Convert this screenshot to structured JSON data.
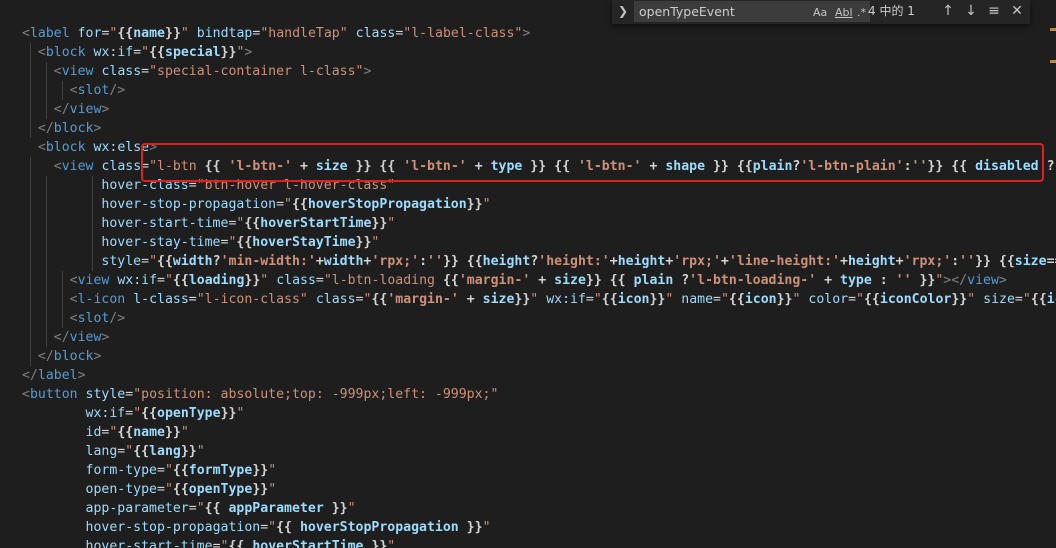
{
  "find": {
    "toggle_icon": "chevron-right-icon",
    "query": "openTypeEvent",
    "options": [
      "Aa",
      "Abl",
      ".*"
    ],
    "count": "4 中的 1",
    "prev_icon": "arrow-up-icon",
    "next_icon": "arrow-down-icon",
    "selection_icon": "find-in-selection-icon",
    "close_icon": "close-icon"
  },
  "colors": {
    "background": "#1e1e1e",
    "tag": "#569cd6",
    "attribute": "#9cdcfe",
    "string": "#ce9178",
    "punctuation": "#808080",
    "highlight_box": "#e0201c"
  },
  "lines": [
    [
      [
        "pun",
        "<"
      ],
      [
        "tag",
        "label"
      ],
      [
        "txt",
        " "
      ],
      [
        "attr",
        "for"
      ],
      [
        "txt",
        "="
      ],
      [
        "str",
        "\""
      ],
      [
        "expp",
        "{{"
      ],
      [
        "expr",
        "name"
      ],
      [
        "expp",
        "}}"
      ],
      [
        "str",
        "\""
      ],
      [
        "txt",
        " "
      ],
      [
        "attr",
        "bindtap"
      ],
      [
        "txt",
        "="
      ],
      [
        "str",
        "\"handleTap\""
      ],
      [
        "txt",
        " "
      ],
      [
        "attr",
        "class"
      ],
      [
        "txt",
        "="
      ],
      [
        "str",
        "\"l-label-class\""
      ],
      [
        "pun",
        ">"
      ]
    ],
    [
      [
        "txt",
        "  "
      ],
      [
        "pun",
        "<"
      ],
      [
        "tag",
        "block"
      ],
      [
        "txt",
        " "
      ],
      [
        "attr",
        "wx:if"
      ],
      [
        "txt",
        "="
      ],
      [
        "str",
        "\""
      ],
      [
        "expp",
        "{{"
      ],
      [
        "expr",
        "special"
      ],
      [
        "expp",
        "}}"
      ],
      [
        "str",
        "\""
      ],
      [
        "pun",
        ">"
      ]
    ],
    [
      [
        "txt",
        "    "
      ],
      [
        "pun",
        "<"
      ],
      [
        "tag",
        "view"
      ],
      [
        "txt",
        " "
      ],
      [
        "attr",
        "class"
      ],
      [
        "txt",
        "="
      ],
      [
        "str",
        "\"special-container l-class\""
      ],
      [
        "pun",
        ">"
      ]
    ],
    [
      [
        "txt",
        "      "
      ],
      [
        "pun",
        "<"
      ],
      [
        "tag",
        "slot"
      ],
      [
        "pun",
        "/>"
      ]
    ],
    [
      [
        "txt",
        "    "
      ],
      [
        "pun",
        "</"
      ],
      [
        "tag",
        "view"
      ],
      [
        "pun",
        ">"
      ]
    ],
    [
      [
        "txt",
        "  "
      ],
      [
        "pun",
        "</"
      ],
      [
        "tag",
        "block"
      ],
      [
        "pun",
        ">"
      ]
    ],
    [
      [
        "txt",
        "  "
      ],
      [
        "pun",
        "<"
      ],
      [
        "tag",
        "block"
      ],
      [
        "txt",
        " "
      ],
      [
        "attr",
        "wx:else"
      ],
      [
        "pun",
        ">"
      ]
    ],
    [
      [
        "txt",
        "    "
      ],
      [
        "pun",
        "<"
      ],
      [
        "tag",
        "view"
      ],
      [
        "txt",
        " "
      ],
      [
        "attr",
        "class"
      ],
      [
        "txt",
        "="
      ],
      [
        "str",
        "\"l-btn "
      ],
      [
        "expp",
        "{{ "
      ],
      [
        "strb",
        "'l-btn-'"
      ],
      [
        "expp",
        " + "
      ],
      [
        "expr",
        "size"
      ],
      [
        "expp",
        " }}"
      ],
      [
        "str",
        " "
      ],
      [
        "expp",
        "{{ "
      ],
      [
        "strb",
        "'l-btn-'"
      ],
      [
        "expp",
        " + "
      ],
      [
        "expr",
        "type"
      ],
      [
        "expp",
        " }}"
      ],
      [
        "str",
        " "
      ],
      [
        "expp",
        "{{ "
      ],
      [
        "strb",
        "'l-btn-'"
      ],
      [
        "expp",
        " + "
      ],
      [
        "expr",
        "shape"
      ],
      [
        "expp",
        " }}"
      ],
      [
        "str",
        " "
      ],
      [
        "expp",
        "{{"
      ],
      [
        "expr",
        "plain"
      ],
      [
        "expp",
        "?"
      ],
      [
        "strb",
        "'l-btn-plain'"
      ],
      [
        "expp",
        ":"
      ],
      [
        "strb",
        "''"
      ],
      [
        "expp",
        "}}"
      ],
      [
        "str",
        " "
      ],
      [
        "expp",
        "{{ "
      ],
      [
        "expr",
        "disabled"
      ],
      [
        "expp",
        " ? "
      ],
      [
        "strb",
        "']"
      ]
    ],
    [
      [
        "txt",
        "          "
      ],
      [
        "attr",
        "hover-class"
      ],
      [
        "txt",
        "="
      ],
      [
        "str",
        "\"btn-hover l-hover-class\""
      ]
    ],
    [
      [
        "txt",
        "          "
      ],
      [
        "attr",
        "hover-stop-propagation"
      ],
      [
        "txt",
        "="
      ],
      [
        "str",
        "\""
      ],
      [
        "expp",
        "{{"
      ],
      [
        "expr",
        "hoverStopPropagation"
      ],
      [
        "expp",
        "}}"
      ],
      [
        "str",
        "\""
      ]
    ],
    [
      [
        "txt",
        "          "
      ],
      [
        "attr",
        "hover-start-time"
      ],
      [
        "txt",
        "="
      ],
      [
        "str",
        "\""
      ],
      [
        "expp",
        "{{"
      ],
      [
        "expr",
        "hoverStartTime"
      ],
      [
        "expp",
        "}}"
      ],
      [
        "str",
        "\""
      ]
    ],
    [
      [
        "txt",
        "          "
      ],
      [
        "attr",
        "hover-stay-time"
      ],
      [
        "txt",
        "="
      ],
      [
        "str",
        "\""
      ],
      [
        "expp",
        "{{"
      ],
      [
        "expr",
        "hoverStayTime"
      ],
      [
        "expp",
        "}}"
      ],
      [
        "str",
        "\""
      ]
    ],
    [
      [
        "txt",
        "          "
      ],
      [
        "attr",
        "style"
      ],
      [
        "txt",
        "="
      ],
      [
        "str",
        "\""
      ],
      [
        "expp",
        "{{"
      ],
      [
        "expr",
        "width"
      ],
      [
        "expp",
        "?"
      ],
      [
        "strb",
        "'min-width:'"
      ],
      [
        "expp",
        "+"
      ],
      [
        "expr",
        "width"
      ],
      [
        "expp",
        "+"
      ],
      [
        "strb",
        "'rpx;'"
      ],
      [
        "expp",
        ":"
      ],
      [
        "strb",
        "''"
      ],
      [
        "expp",
        "}}"
      ],
      [
        "str",
        " "
      ],
      [
        "expp",
        "{{"
      ],
      [
        "expr",
        "height"
      ],
      [
        "expp",
        "?"
      ],
      [
        "strb",
        "'height:'"
      ],
      [
        "expp",
        "+"
      ],
      [
        "expr",
        "height"
      ],
      [
        "expp",
        "+"
      ],
      [
        "strb",
        "'rpx;'"
      ],
      [
        "expp",
        "+"
      ],
      [
        "strb",
        "'line-height:'"
      ],
      [
        "expp",
        "+"
      ],
      [
        "expr",
        "height"
      ],
      [
        "expp",
        "+"
      ],
      [
        "strb",
        "'rpx;'"
      ],
      [
        "expp",
        ":"
      ],
      [
        "strb",
        "''"
      ],
      [
        "expp",
        "}}"
      ],
      [
        "str",
        " "
      ],
      [
        "expp",
        "{{"
      ],
      [
        "expr",
        "size"
      ],
      [
        "expp",
        "=="
      ],
      [
        "strb",
        "'l"
      ]
    ],
    [
      [
        "txt",
        "      "
      ],
      [
        "pun",
        "<"
      ],
      [
        "tag",
        "view"
      ],
      [
        "txt",
        " "
      ],
      [
        "attr",
        "wx:if"
      ],
      [
        "txt",
        "="
      ],
      [
        "str",
        "\""
      ],
      [
        "expp",
        "{{"
      ],
      [
        "expr",
        "loading"
      ],
      [
        "expp",
        "}}"
      ],
      [
        "str",
        "\""
      ],
      [
        "txt",
        " "
      ],
      [
        "attr",
        "class"
      ],
      [
        "txt",
        "="
      ],
      [
        "str",
        "\"l-btn-loading "
      ],
      [
        "expp",
        "{{"
      ],
      [
        "strb",
        "'margin-'"
      ],
      [
        "expp",
        " + "
      ],
      [
        "expr",
        "size"
      ],
      [
        "expp",
        "}}"
      ],
      [
        "str",
        " "
      ],
      [
        "expp",
        "{{ "
      ],
      [
        "expr",
        "plain"
      ],
      [
        "expp",
        " ?"
      ],
      [
        "strb",
        "'l-btn-loading-'"
      ],
      [
        "expp",
        " + "
      ],
      [
        "expr",
        "type"
      ],
      [
        "expp",
        " : "
      ],
      [
        "strb",
        "''"
      ],
      [
        "expp",
        " }}"
      ],
      [
        "str",
        "\""
      ],
      [
        "pun",
        "></"
      ],
      [
        "tag",
        "view"
      ],
      [
        "pun",
        ">"
      ]
    ],
    [
      [
        "txt",
        "      "
      ],
      [
        "pun",
        "<"
      ],
      [
        "tag",
        "l-icon"
      ],
      [
        "txt",
        " "
      ],
      [
        "attr",
        "l-class"
      ],
      [
        "txt",
        "="
      ],
      [
        "str",
        "\"l-icon-class\""
      ],
      [
        "txt",
        " "
      ],
      [
        "attr",
        "class"
      ],
      [
        "txt",
        "="
      ],
      [
        "str",
        "\""
      ],
      [
        "expp",
        "{{"
      ],
      [
        "strb",
        "'margin-'"
      ],
      [
        "expp",
        " + "
      ],
      [
        "expr",
        "size"
      ],
      [
        "expp",
        "}}"
      ],
      [
        "str",
        "\""
      ],
      [
        "txt",
        " "
      ],
      [
        "attr",
        "wx:if"
      ],
      [
        "txt",
        "="
      ],
      [
        "str",
        "\""
      ],
      [
        "expp",
        "{{"
      ],
      [
        "expr",
        "icon"
      ],
      [
        "expp",
        "}}"
      ],
      [
        "str",
        "\""
      ],
      [
        "txt",
        " "
      ],
      [
        "attr",
        "name"
      ],
      [
        "txt",
        "="
      ],
      [
        "str",
        "\""
      ],
      [
        "expp",
        "{{"
      ],
      [
        "expr",
        "icon"
      ],
      [
        "expp",
        "}}"
      ],
      [
        "str",
        "\""
      ],
      [
        "txt",
        " "
      ],
      [
        "attr",
        "color"
      ],
      [
        "txt",
        "="
      ],
      [
        "str",
        "\""
      ],
      [
        "expp",
        "{{"
      ],
      [
        "expr",
        "iconColor"
      ],
      [
        "expp",
        "}}"
      ],
      [
        "str",
        "\""
      ],
      [
        "txt",
        " "
      ],
      [
        "attr",
        "size"
      ],
      [
        "txt",
        "="
      ],
      [
        "str",
        "\""
      ],
      [
        "expp",
        "{{"
      ],
      [
        "expr",
        "icon"
      ]
    ],
    [
      [
        "txt",
        "      "
      ],
      [
        "pun",
        "<"
      ],
      [
        "tag",
        "slot"
      ],
      [
        "pun",
        "/>"
      ]
    ],
    [
      [
        "txt",
        "    "
      ],
      [
        "pun",
        "</"
      ],
      [
        "tag",
        "view"
      ],
      [
        "pun",
        ">"
      ]
    ],
    [
      [
        "txt",
        "  "
      ],
      [
        "pun",
        "</"
      ],
      [
        "tag",
        "block"
      ],
      [
        "pun",
        ">"
      ]
    ],
    [
      [
        "pun",
        "</"
      ],
      [
        "tag",
        "label"
      ],
      [
        "pun",
        ">"
      ]
    ],
    [
      [
        "pun",
        "<"
      ],
      [
        "tag",
        "button"
      ],
      [
        "txt",
        " "
      ],
      [
        "attr",
        "style"
      ],
      [
        "txt",
        "="
      ],
      [
        "str",
        "\"position: absolute;top: -999px;left: -999px;\""
      ]
    ],
    [
      [
        "txt",
        "        "
      ],
      [
        "attr",
        "wx:if"
      ],
      [
        "txt",
        "="
      ],
      [
        "str",
        "\""
      ],
      [
        "expp",
        "{{"
      ],
      [
        "expr",
        "openType"
      ],
      [
        "expp",
        "}}"
      ],
      [
        "str",
        "\""
      ]
    ],
    [
      [
        "txt",
        "        "
      ],
      [
        "attr",
        "id"
      ],
      [
        "txt",
        "="
      ],
      [
        "str",
        "\""
      ],
      [
        "expp",
        "{{"
      ],
      [
        "expr",
        "name"
      ],
      [
        "expp",
        "}}"
      ],
      [
        "str",
        "\""
      ]
    ],
    [
      [
        "txt",
        "        "
      ],
      [
        "attr",
        "lang"
      ],
      [
        "txt",
        "="
      ],
      [
        "str",
        "\""
      ],
      [
        "expp",
        "{{"
      ],
      [
        "expr",
        "lang"
      ],
      [
        "expp",
        "}}"
      ],
      [
        "str",
        "\""
      ]
    ],
    [
      [
        "txt",
        "        "
      ],
      [
        "attr",
        "form-type"
      ],
      [
        "txt",
        "="
      ],
      [
        "str",
        "\""
      ],
      [
        "expp",
        "{{"
      ],
      [
        "expr",
        "formType"
      ],
      [
        "expp",
        "}}"
      ],
      [
        "str",
        "\""
      ]
    ],
    [
      [
        "txt",
        "        "
      ],
      [
        "attr",
        "open-type"
      ],
      [
        "txt",
        "="
      ],
      [
        "str",
        "\""
      ],
      [
        "expp",
        "{{"
      ],
      [
        "expr",
        "openType"
      ],
      [
        "expp",
        "}}"
      ],
      [
        "str",
        "\""
      ]
    ],
    [
      [
        "txt",
        "        "
      ],
      [
        "attr",
        "app-parameter"
      ],
      [
        "txt",
        "="
      ],
      [
        "str",
        "\""
      ],
      [
        "expp",
        "{{ "
      ],
      [
        "expr",
        "appParameter"
      ],
      [
        "expp",
        " }}"
      ],
      [
        "str",
        "\""
      ]
    ],
    [
      [
        "txt",
        "        "
      ],
      [
        "attr",
        "hover-stop-propagation"
      ],
      [
        "txt",
        "="
      ],
      [
        "str",
        "\""
      ],
      [
        "expp",
        "{{ "
      ],
      [
        "expr",
        "hoverStopPropagation"
      ],
      [
        "expp",
        " }}"
      ],
      [
        "str",
        "\""
      ]
    ],
    [
      [
        "txt",
        "        "
      ],
      [
        "attr",
        "hover-start-time"
      ],
      [
        "txt",
        "="
      ],
      [
        "str",
        "\""
      ],
      [
        "expp",
        "{{ "
      ],
      [
        "expr",
        "hoverStartTime"
      ],
      [
        "expp",
        " }}"
      ],
      [
        "str",
        "\""
      ]
    ]
  ]
}
